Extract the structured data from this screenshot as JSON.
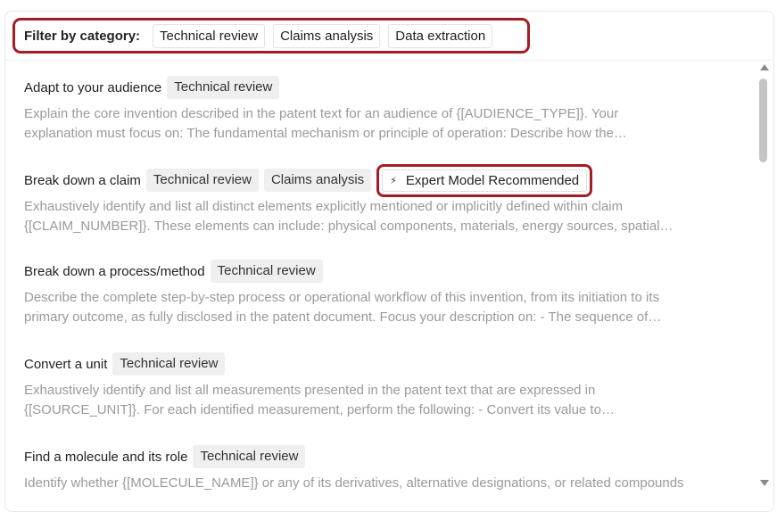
{
  "filter": {
    "label": "Filter by category:",
    "chips": [
      "Technical review",
      "Claims analysis",
      "Data extraction"
    ]
  },
  "items": [
    {
      "title": "Adapt to your audience",
      "tags": [
        "Technical review"
      ],
      "desc": [
        "Explain the core invention described in the patent text for an audience of {[AUDIENCE_TYPE]}. Your",
        "explanation must focus on: The fundamental mechanism or principle of operation: Describe how the…"
      ]
    },
    {
      "title": "Break down a claim",
      "tags": [
        "Technical review",
        "Claims analysis"
      ],
      "badge": "Expert Model Recommended",
      "desc": [
        "Exhaustively identify and list all distinct elements explicitly mentioned or implicitly defined within claim",
        "{[CLAIM_NUMBER]}. These elements can include: physical components, materials, energy sources, spatial…"
      ]
    },
    {
      "title": "Break down a process/method",
      "tags": [
        "Technical review"
      ],
      "desc": [
        "Describe the complete step-by-step process or operational workflow of this invention, from its initiation to its",
        "primary outcome, as fully disclosed in the patent document. Focus your description on: - The sequence of…"
      ]
    },
    {
      "title": "Convert a unit",
      "tags": [
        "Technical review"
      ],
      "desc": [
        "Exhaustively identify and list all measurements presented in the patent text that are expressed in",
        "{[SOURCE_UNIT]}. For each identified measurement, perform the following: - Convert its value to…"
      ]
    },
    {
      "title": "Find a molecule and its role",
      "tags": [
        "Technical review"
      ],
      "desc": [
        "Identify whether {[MOLECULE_NAME]} or any of its derivatives, alternative designations, or related compounds"
      ]
    }
  ]
}
